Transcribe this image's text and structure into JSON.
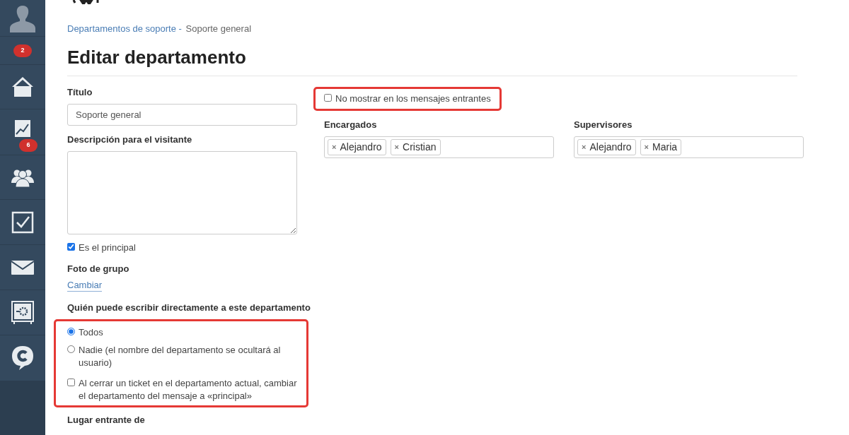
{
  "sidebar": {
    "items": [
      {
        "kind": "avatar"
      },
      {
        "kind": "badge",
        "badge": "2"
      },
      {
        "kind": "home"
      },
      {
        "kind": "chart",
        "badge": "6"
      },
      {
        "kind": "team"
      },
      {
        "kind": "tasks"
      },
      {
        "kind": "mail"
      },
      {
        "kind": "safe"
      },
      {
        "kind": "chat"
      }
    ]
  },
  "breadcrumb": {
    "link": "Departamentos de soporte",
    "separator": "-",
    "current": "Soporte general"
  },
  "title": "Editar departamento",
  "form": {
    "remove_mark": "×",
    "title_label": "Título",
    "title_value": "Soporte general",
    "description_label": "Descripción para el visitante",
    "principal": {
      "label": "Es el principal",
      "checked": true
    },
    "photo_label": "Foto de grupo",
    "photo_link": "Cambiar",
    "who_label": "Quién puede escribir directamente a este departamento",
    "who_options": [
      {
        "label": "Todos",
        "selected": true
      },
      {
        "label": "Nadie (el nombre del departamento se ocultará al usuario)",
        "selected": false
      }
    ],
    "close_option": {
      "label": "Al cerrar un ticket en el departamento actual, cambiar el departamento del mensaje a «principal»",
      "checked": false
    },
    "incoming_label": "Lugar entrante de",
    "hide_incoming": {
      "label": "No mostrar en los mensajes entrantes",
      "checked": false
    },
    "managers": {
      "label": "Encargados",
      "tags": [
        "Alejandro",
        "Cristian"
      ]
    },
    "supervisors": {
      "label": "Supervisores",
      "tags": [
        "Alejandro",
        "Maria"
      ]
    }
  }
}
